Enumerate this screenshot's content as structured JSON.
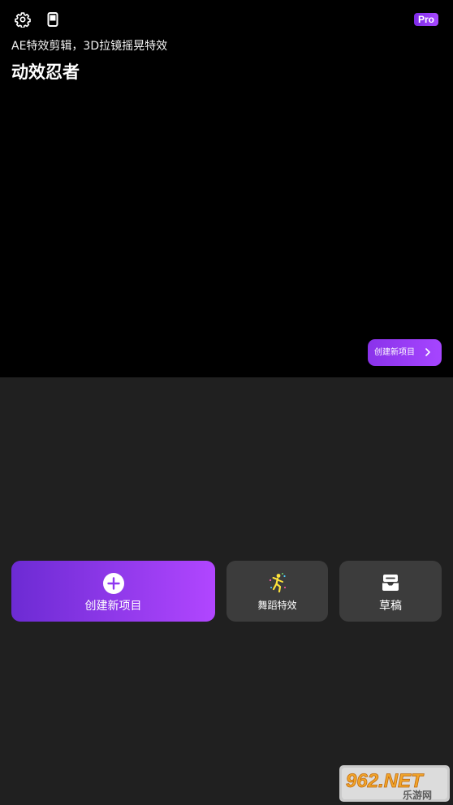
{
  "header": {
    "settings_icon": "gear-icon",
    "phone_icon": "phone-icon",
    "pro_badge": "Pro",
    "subtitle": "AE特效剪辑，3D拉镜摇晃特效",
    "title": "动效忍者",
    "create_label": "创建新项目"
  },
  "actions": {
    "create_label": "创建新项目",
    "dance_label": "舞蹈特效",
    "drafts_label": "草稿"
  },
  "watermark": {
    "brand": "962.NET",
    "sub": "乐游网"
  },
  "colors": {
    "hero_bg": "#000000",
    "panel_bg": "#202020",
    "accent_start": "#6c2bd3",
    "accent_end": "#b146ff",
    "card_bg": "#3c3c3c"
  }
}
